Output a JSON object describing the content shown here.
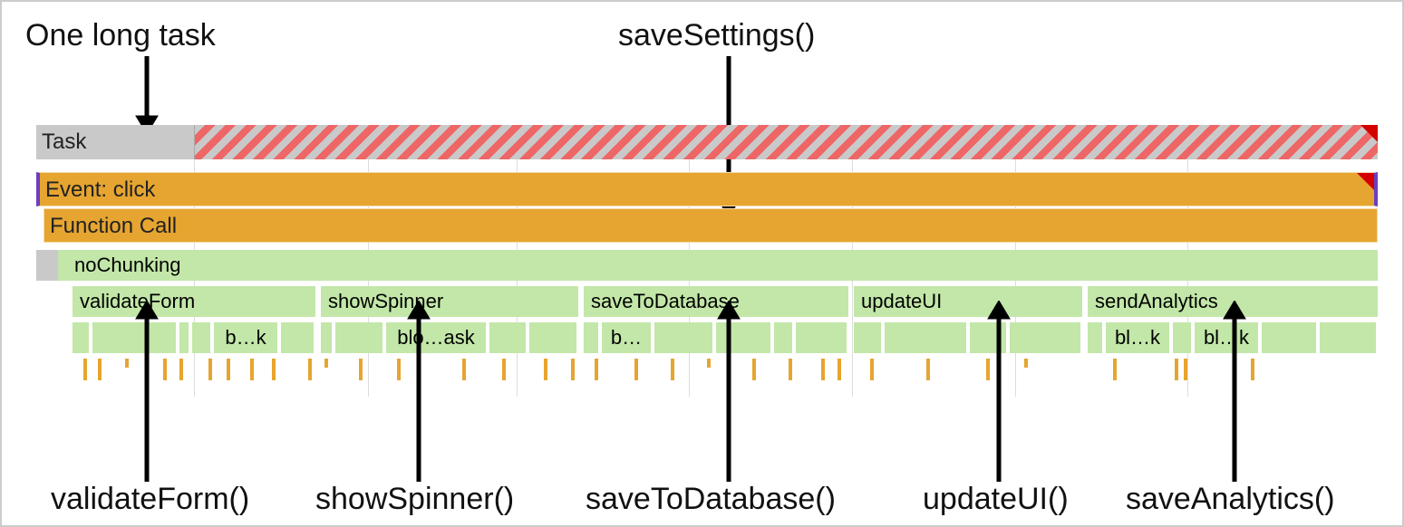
{
  "annotations": {
    "top_left": "One long task",
    "top_center": "saveSettings()",
    "bottom": {
      "validateForm": "validateForm()",
      "showSpinner": "showSpinner()",
      "saveToDatabase": "saveToDatabase()",
      "updateUI": "updateUI()",
      "saveAnalytics": "saveAnalytics()"
    }
  },
  "flame": {
    "task_label": "Task",
    "event_label": "Event: click",
    "function_call_label": "Function Call",
    "no_chunking_label": "noChunking",
    "functions": [
      {
        "label": "validateForm"
      },
      {
        "label": "showSpinner"
      },
      {
        "label": "saveToDatabase"
      },
      {
        "label": "updateUI"
      },
      {
        "label": "sendAnalytics"
      }
    ],
    "subblocks": {
      "b1": "b…k",
      "b2": "blo…ask",
      "b3": "b…",
      "b4": "bl…k",
      "b5": "bl…k"
    }
  }
}
